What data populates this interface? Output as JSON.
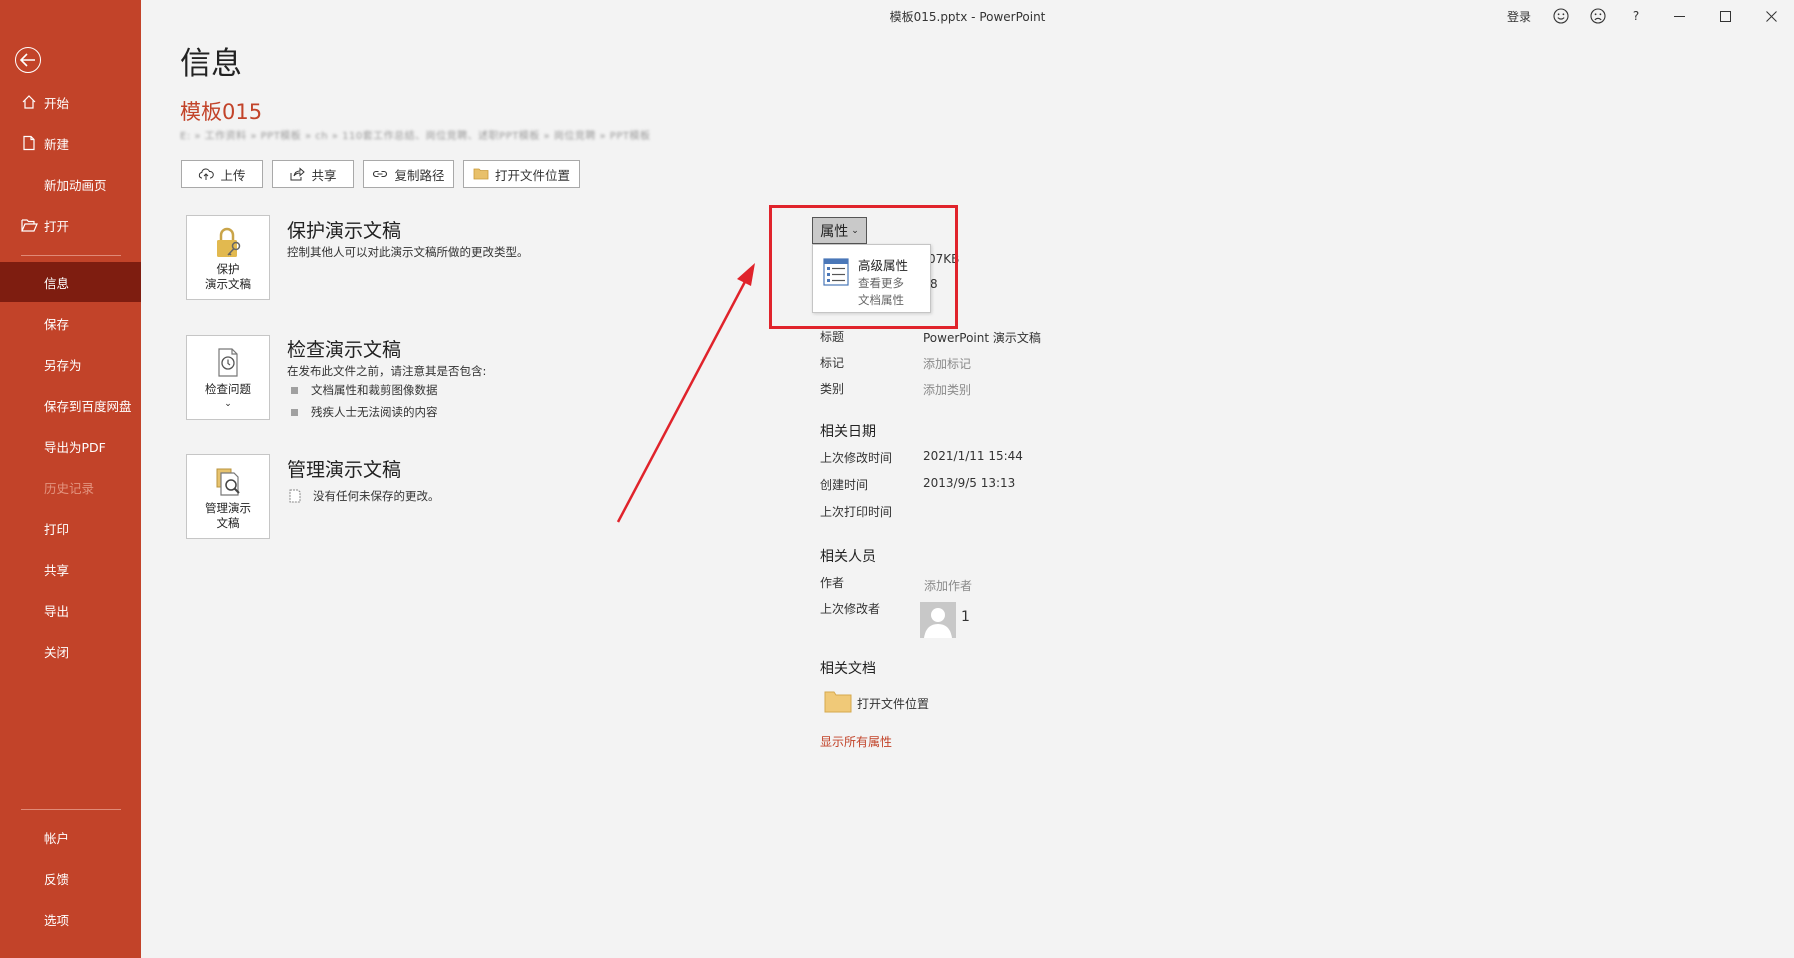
{
  "window": {
    "title": "模板015.pptx  -  PowerPoint",
    "login": "登录",
    "help": "?"
  },
  "sidebar": {
    "top_items": [
      {
        "label": "开始",
        "icon": "home-icon"
      },
      {
        "label": "新建",
        "icon": "new-doc-icon"
      },
      {
        "label": "新加动画页",
        "icon": ""
      },
      {
        "label": "打开",
        "icon": "open-folder-icon"
      },
      {
        "label": "信息",
        "icon": "",
        "active": true
      },
      {
        "label": "保存",
        "icon": ""
      },
      {
        "label": "另存为",
        "icon": ""
      },
      {
        "label": "保存到百度网盘",
        "icon": ""
      },
      {
        "label": "导出为PDF",
        "icon": ""
      },
      {
        "label": "历史记录",
        "icon": "",
        "disabled": true
      },
      {
        "label": "打印",
        "icon": ""
      },
      {
        "label": "共享",
        "icon": ""
      },
      {
        "label": "导出",
        "icon": ""
      },
      {
        "label": "关闭",
        "icon": ""
      }
    ],
    "bottom_items": [
      {
        "label": "帐户"
      },
      {
        "label": "反馈"
      },
      {
        "label": "选项"
      }
    ]
  },
  "page": {
    "title": "信息",
    "doc_name": "模板015",
    "doc_path": "E: » 工作资料 » PPT模板 » ch » 110套工作总结、岗位竞聘、述职PPT模板 » 岗位竞聘 » PPT模板"
  },
  "actions": {
    "upload": "上传",
    "share": "共享",
    "copy_path": "复制路径",
    "open_location": "打开文件位置"
  },
  "sections": {
    "protect": {
      "btn_line1": "保护",
      "btn_line2": "演示文稿",
      "title": "保护演示文稿",
      "desc": "控制其他人可以对此演示文稿所做的更改类型。"
    },
    "inspect": {
      "btn_line1": "检查问题",
      "title": "检查演示文稿",
      "desc": "在发布此文件之前，请注意其是否包含:",
      "bullets": [
        "文档属性和裁剪图像数据",
        "残疾人士无法阅读的内容"
      ]
    },
    "manage": {
      "btn_line1": "管理演示",
      "btn_line2": "文稿",
      "title": "管理演示文稿",
      "desc": "没有任何未保存的更改。"
    }
  },
  "properties": {
    "button": "属性",
    "menu_item1": "高级属性",
    "menu_item2_line1": "查看更多",
    "menu_item2_line2": "文档属性",
    "behind_size": "07KB",
    "behind_num": "8",
    "rows": [
      {
        "label": "标题",
        "value": "PowerPoint 演示文稿",
        "placeholder": false
      },
      {
        "label": "标记",
        "value": "添加标记",
        "placeholder": true
      },
      {
        "label": "类别",
        "value": "添加类别",
        "placeholder": true
      }
    ],
    "dates_heading": "相关日期",
    "dates": [
      {
        "label": "上次修改时间",
        "value": "2021/1/11 15:44"
      },
      {
        "label": "创建时间",
        "value": "2013/9/5 13:13"
      },
      {
        "label": "上次打印时间",
        "value": ""
      }
    ],
    "people_heading": "相关人员",
    "author_label": "作者",
    "author_value": "添加作者",
    "modifier_label": "上次修改者",
    "modifier_value": "1",
    "docs_heading": "相关文档",
    "open_location": "打开文件位置",
    "show_all": "显示所有属性"
  },
  "colors": {
    "accent": "#c24329",
    "active_nav": "#7e1d10",
    "annotation": "#e0232b"
  }
}
